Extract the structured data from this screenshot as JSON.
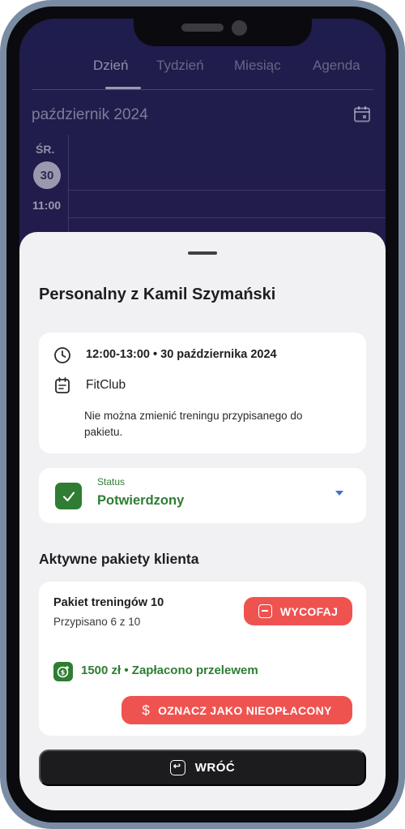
{
  "calendar": {
    "tabs": [
      {
        "label": "Dzień",
        "active": true
      },
      {
        "label": "Tydzień",
        "active": false
      },
      {
        "label": "Miesiąc",
        "active": false
      },
      {
        "label": "Agenda",
        "active": false
      }
    ],
    "month": "październik 2024",
    "day_abbr": "ŚR.",
    "day_number": "30",
    "hour": "11:00"
  },
  "sheet": {
    "title": "Personalny z Kamil Szymański",
    "info": {
      "time": "12:00-13:00 • 30 października 2024",
      "place": "FitClub",
      "notice": "Nie można zmienić treningu przypisanego do pakietu."
    },
    "status": {
      "label": "Status",
      "value": "Potwierdzony"
    },
    "packages_title": "Aktywne pakiety klienta",
    "package": {
      "name": "Pakiet treningów 10",
      "assigned": "Przypisano 6 z 10",
      "withdraw_label": "WYCOFAJ",
      "payment": "1500 zł • Zapłacono przelewem",
      "mark_unpaid_label": "OZNACZ JAKO NIEOPŁACONY"
    },
    "back_label": "WRÓĆ"
  },
  "colors": {
    "success": "#2e7d32",
    "danger": "#ef5350",
    "accent": "#3b6fd8",
    "dark_button": "#1c1c1e"
  },
  "icons": [
    "clock-icon",
    "calendar-note-icon",
    "calendar-icon",
    "check-icon",
    "chevron-down-icon",
    "minus-square-icon",
    "money-icon",
    "dollar-icon",
    "return-icon"
  ]
}
